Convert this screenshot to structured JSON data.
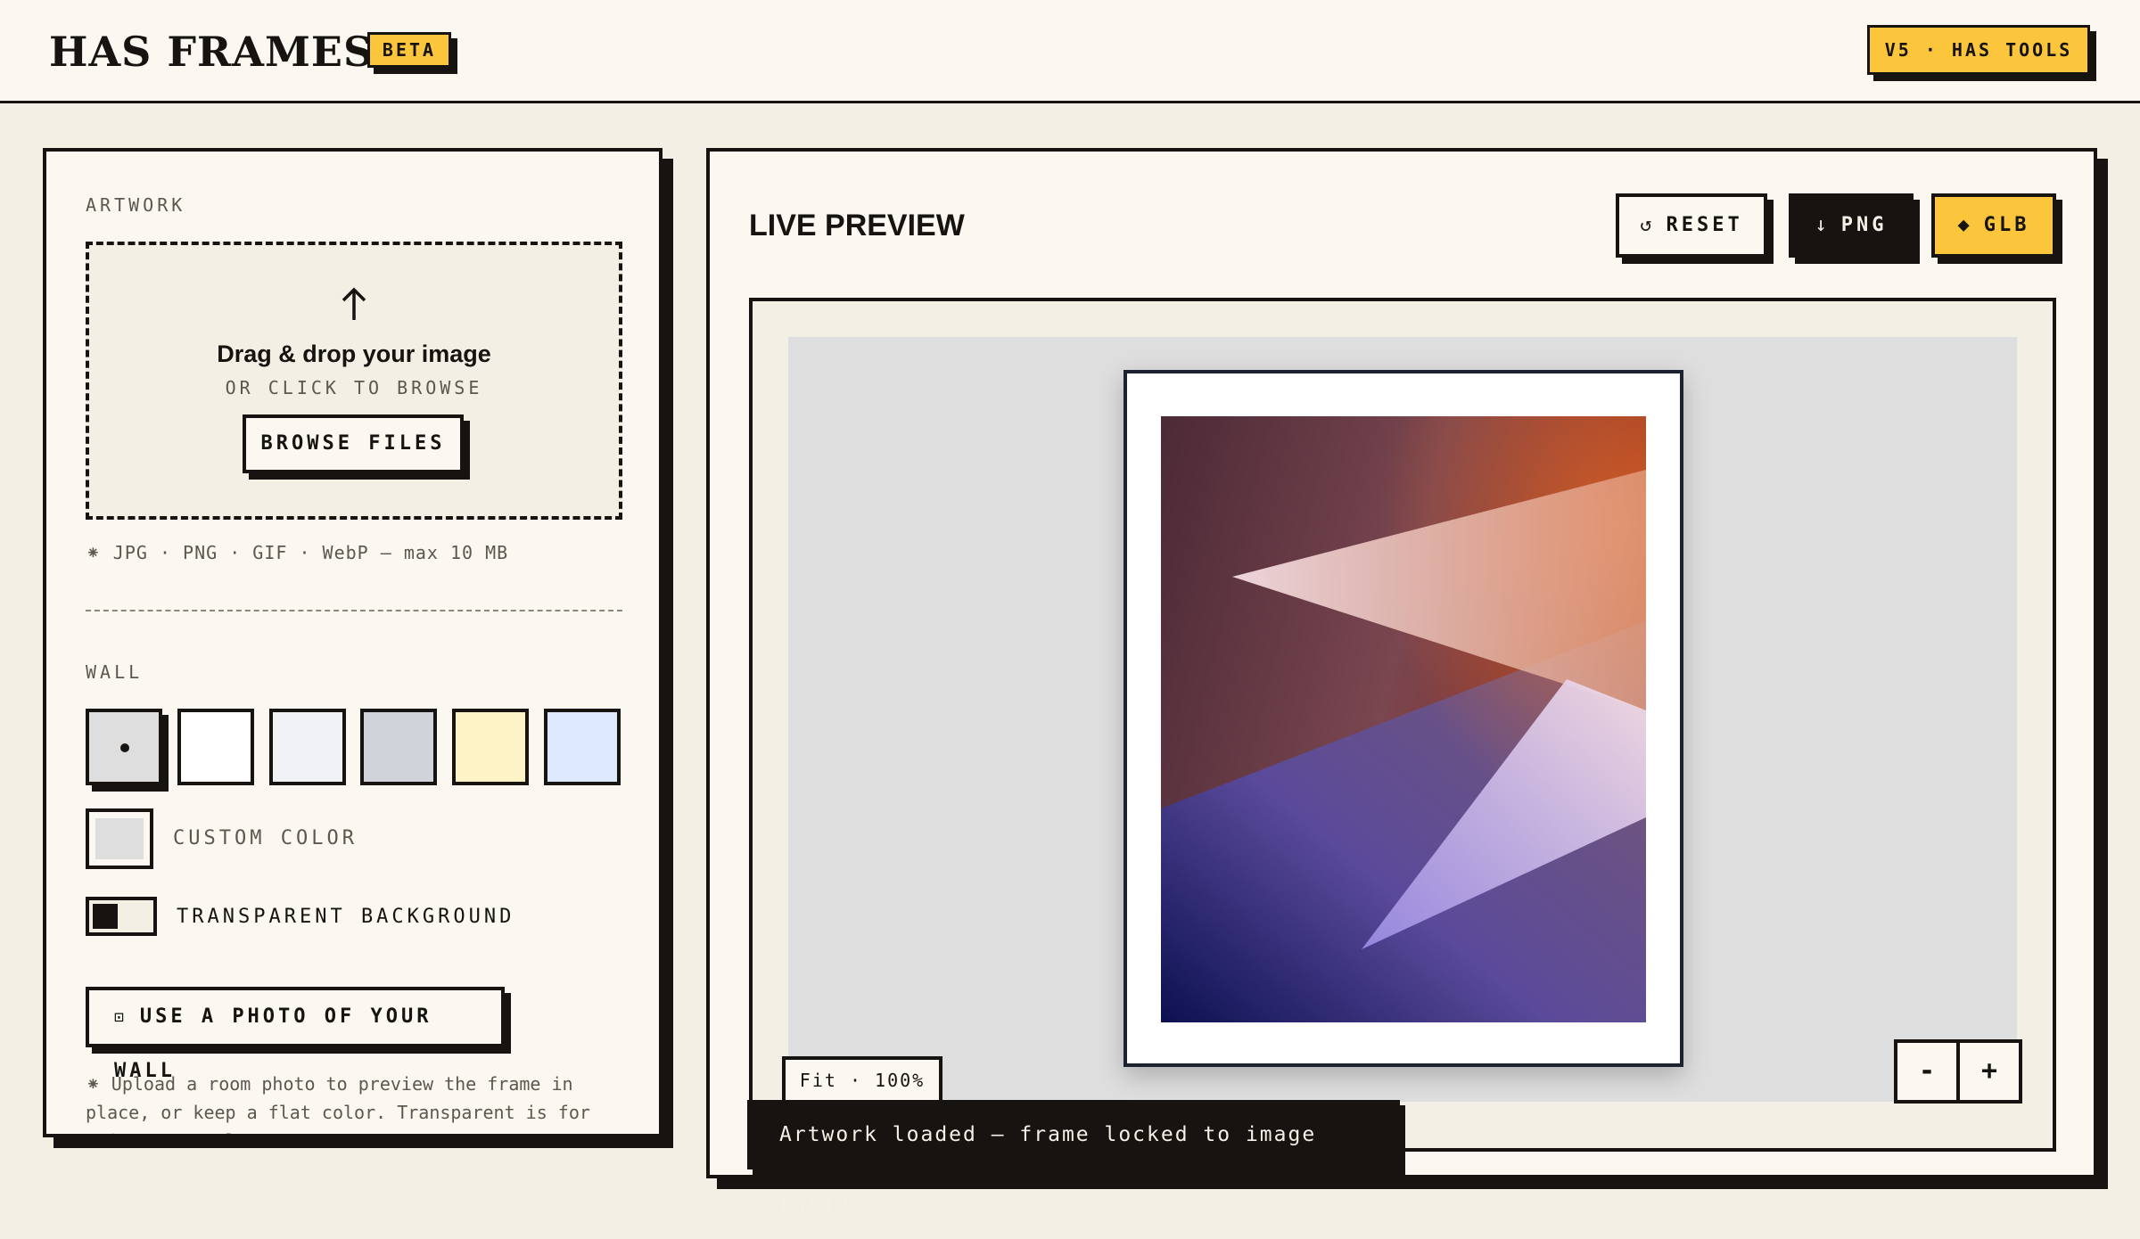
{
  "header": {
    "brand": "HAS FRAMES",
    "beta_badge": "BETA",
    "version_badge": "V5 · HAS TOOLS"
  },
  "artwork": {
    "section_label": "ARTWORK",
    "upload_icon": "arrow-up-icon",
    "drop_title": "Drag & drop your image",
    "drop_subtitle": "OR CLICK TO BROWSE",
    "browse_label": "BROWSE FILES",
    "formats_note": "⁕ JPG · PNG · GIF · WebP — max 10 MB"
  },
  "wall": {
    "section_label": "WALL",
    "swatches": [
      {
        "color": "#dedede",
        "selected": true
      },
      {
        "color": "#ffffff",
        "selected": false
      },
      {
        "color": "#f1f2f5",
        "selected": false
      },
      {
        "color": "#d0d3da",
        "selected": false
      },
      {
        "color": "#fdf3c6",
        "selected": false
      },
      {
        "color": "#dce8fb",
        "selected": false
      }
    ],
    "custom_color_label": "CUSTOM COLOR",
    "custom_color_value": "#dedede",
    "transparent_label": "TRANSPARENT BACKGROUND",
    "photo_button_label": "USE A PHOTO OF YOUR WALL",
    "help_text": "⁕ Upload a room photo to preview the frame in place, or keep a flat color. Transparent is for PNG export only."
  },
  "preview": {
    "title": "LIVE PREVIEW",
    "reset_label": "RESET",
    "reset_icon": "↺",
    "png_label": "PNG",
    "png_icon": "↓",
    "glb_label": "GLB",
    "glb_icon": "◆",
    "fit_label": "Fit · 100%",
    "zoom_out": "-",
    "zoom_in": "+",
    "toast": "Artwork loaded — frame locked to image ratio."
  },
  "colors": {
    "accent": "#fbc53c",
    "ink": "#161310",
    "paper": "#faf8f1",
    "background": "#f2efe5"
  }
}
